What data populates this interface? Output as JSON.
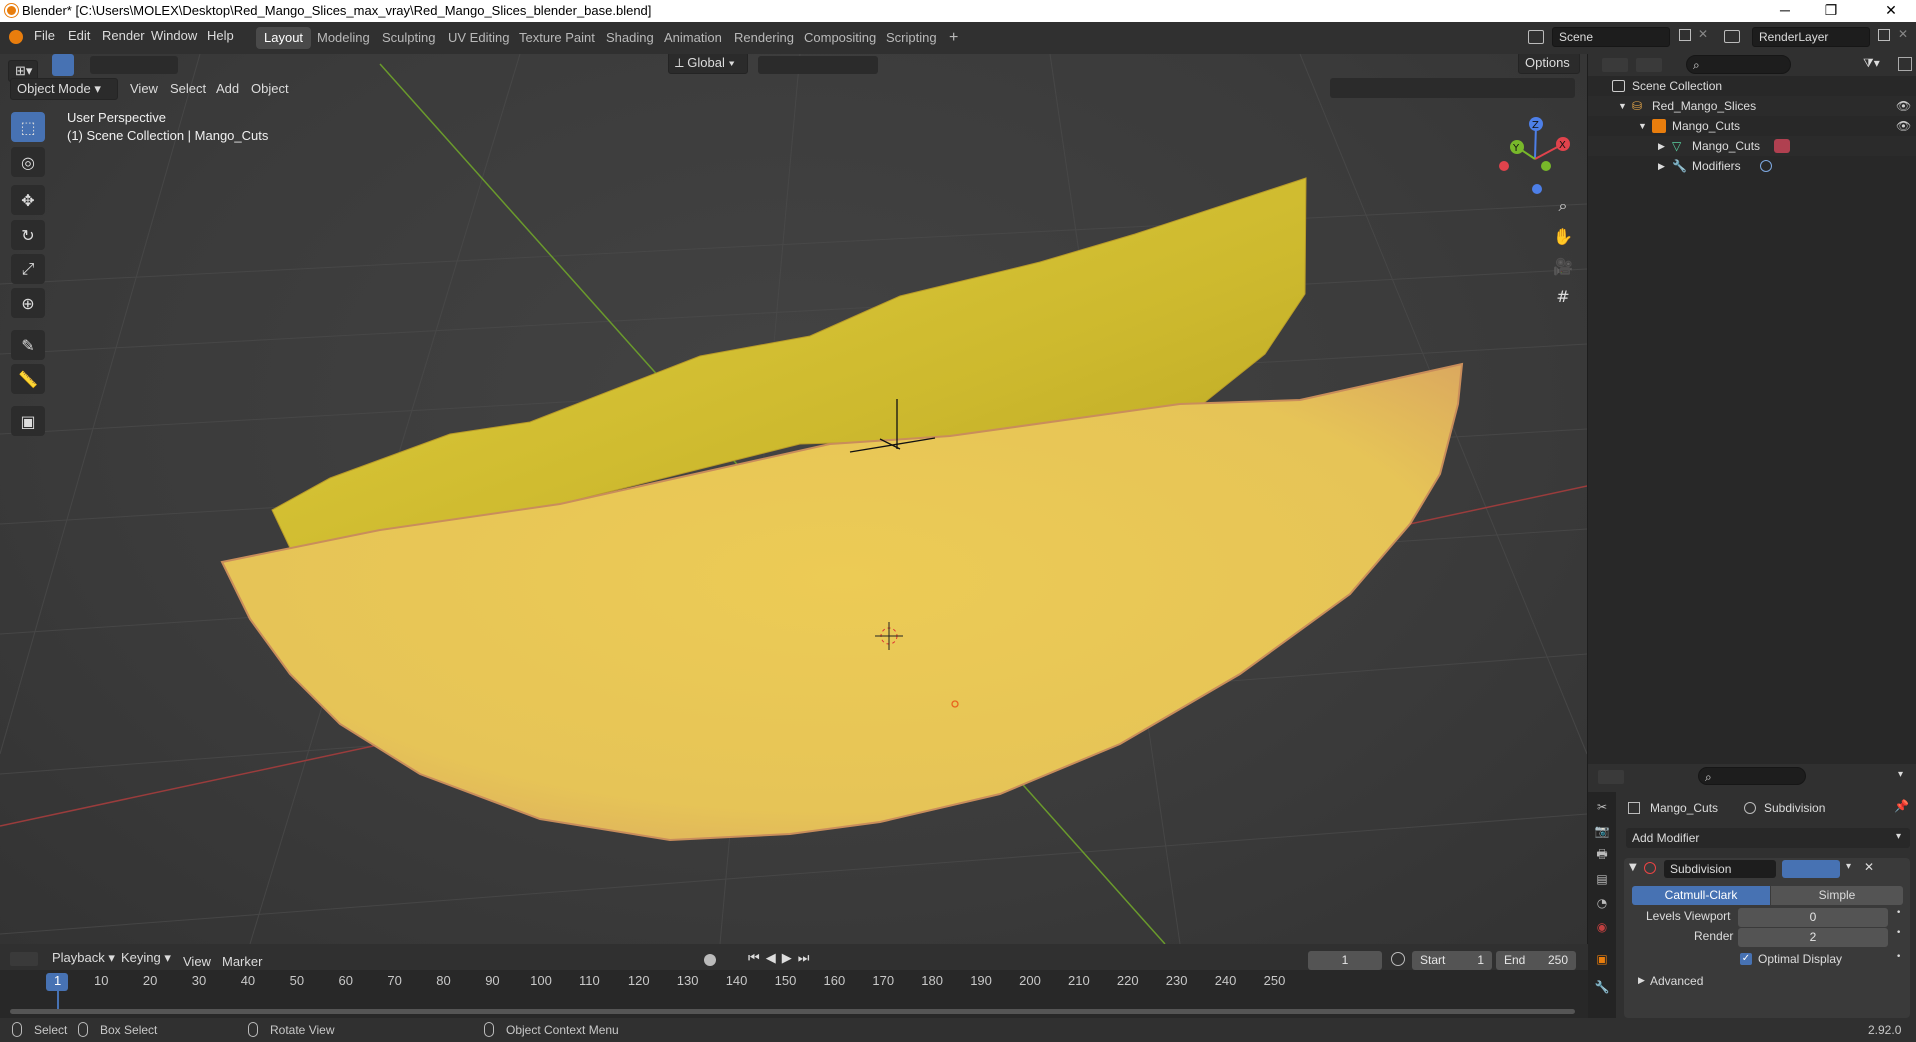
{
  "window": {
    "title": "Blender* [C:\\Users\\MOLEX\\Desktop\\Red_Mango_Slices_max_vray\\Red_Mango_Slices_blender_base.blend]",
    "minimize": "─",
    "maximize": "❐",
    "close": "✕"
  },
  "menu": {
    "file": "File",
    "edit": "Edit",
    "render": "Render",
    "window": "Window",
    "help": "Help"
  },
  "workspaces": [
    "Layout",
    "Modeling",
    "Sculpting",
    "UV Editing",
    "Texture Paint",
    "Shading",
    "Animation",
    "Rendering",
    "Compositing",
    "Scripting"
  ],
  "active_workspace": "Layout",
  "scene": {
    "name": "Scene",
    "render_layer": "RenderLayer"
  },
  "viewport": {
    "mode": "Object Mode",
    "menus": {
      "view": "View",
      "select": "Select",
      "add": "Add",
      "object": "Object"
    },
    "transform_orientation": "Global",
    "options": "Options",
    "perspective": "User Perspective",
    "collection_info": "(1) Scene Collection | Mango_Cuts",
    "gizmo": {
      "x": "X",
      "y": "Y",
      "z": "Z"
    },
    "colors": {
      "mango_top": "#d8c436",
      "mango_front": "#e9c95a",
      "mango_edge": "#c9905a",
      "grid_x": "#9a3c3c",
      "grid_y": "#6a9a2c"
    }
  },
  "outliner": {
    "root": "Scene Collection",
    "items": [
      {
        "label": "Red_Mango_Slices",
        "icon": "collection-icon"
      },
      {
        "label": "Mango_Cuts",
        "icon": "object-icon"
      },
      {
        "label": "Mango_Cuts",
        "icon": "mesh-icon"
      },
      {
        "label": "Modifiers",
        "icon": "wrench-icon"
      }
    ]
  },
  "properties": {
    "object_name": "Mango_Cuts",
    "modifier_breadcrumb": "Subdivision",
    "add_modifier": "Add Modifier",
    "modifier": {
      "name": "Subdivision",
      "types": [
        "Catmull-Clark",
        "Simple"
      ],
      "active_type": "Catmull-Clark",
      "levels_viewport_label": "Levels Viewport",
      "levels_viewport": "0",
      "render_label": "Render",
      "render": "2",
      "optimal_display_label": "Optimal Display",
      "optimal_display": true,
      "advanced_label": "Advanced"
    }
  },
  "timeline": {
    "menus": {
      "playback": "Playback",
      "keying": "Keying",
      "view": "View",
      "marker": "Marker"
    },
    "current_frame": "1",
    "start_label": "Start",
    "start": "1",
    "end_label": "End",
    "end": "250",
    "ticks": [
      "1",
      "10",
      "20",
      "30",
      "40",
      "50",
      "60",
      "70",
      "80",
      "90",
      "100",
      "110",
      "120",
      "130",
      "140",
      "150",
      "160",
      "170",
      "180",
      "190",
      "200",
      "210",
      "220",
      "230",
      "240",
      "250"
    ]
  },
  "statusbar": {
    "select": "Select",
    "box_select": "Box Select",
    "rotate_view": "Rotate View",
    "context_menu": "Object Context Menu",
    "version": "2.92.0"
  }
}
